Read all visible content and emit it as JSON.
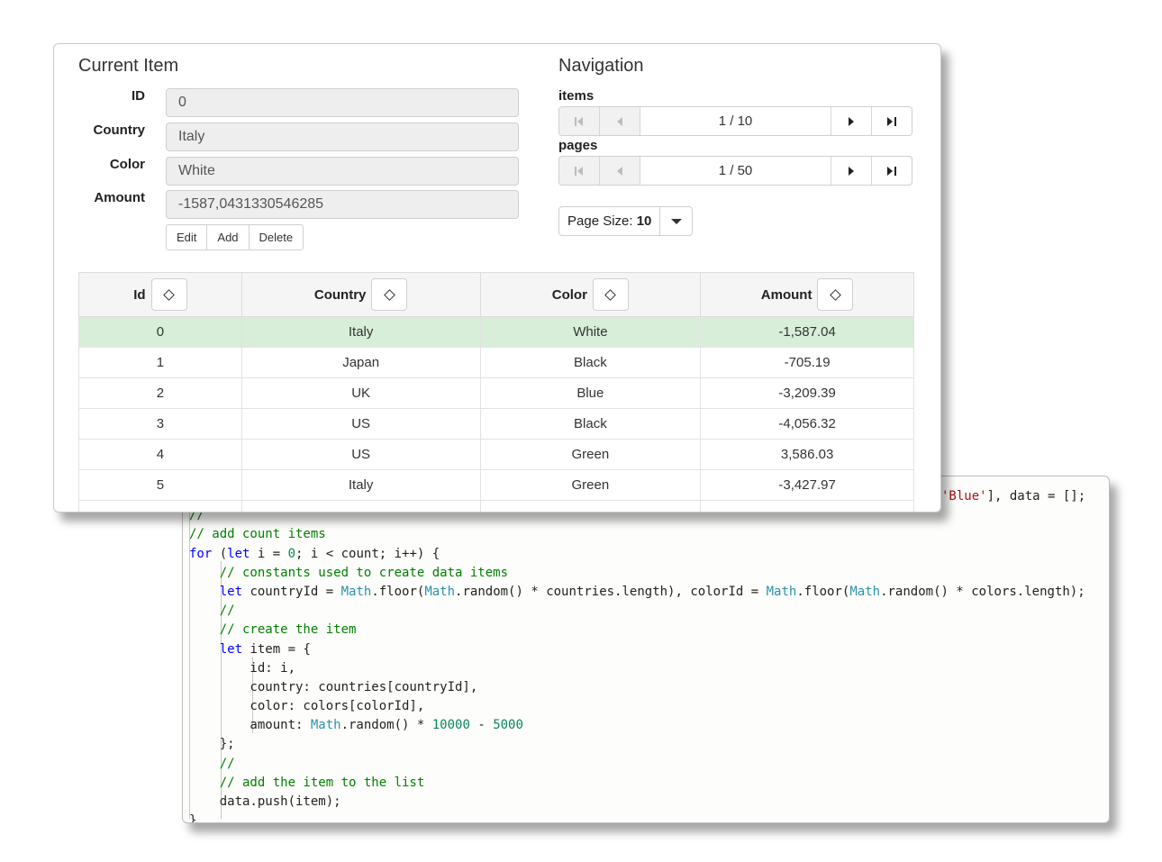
{
  "current_item": {
    "title": "Current Item",
    "fields": [
      {
        "label": "ID",
        "value": "0"
      },
      {
        "label": "Country",
        "value": "Italy"
      },
      {
        "label": "Color",
        "value": "White"
      },
      {
        "label": "Amount",
        "value": "-1587,0431330546285"
      }
    ],
    "buttons": {
      "edit": "Edit",
      "add": "Add",
      "delete": "Delete"
    }
  },
  "navigation": {
    "title": "Navigation",
    "items": {
      "label": "items",
      "position": "1 / 10"
    },
    "pages": {
      "label": "pages",
      "position": "1 / 50"
    },
    "page_size": {
      "label": "Page Size: ",
      "value": "10"
    }
  },
  "grid": {
    "columns": [
      "Id",
      "Country",
      "Color",
      "Amount"
    ],
    "selected_row": 0,
    "rows": [
      [
        "0",
        "Italy",
        "White",
        "-1,587.04"
      ],
      [
        "1",
        "Japan",
        "Black",
        "-705.19"
      ],
      [
        "2",
        "UK",
        "Blue",
        "-3,209.39"
      ],
      [
        "3",
        "US",
        "Black",
        "-4,056.32"
      ],
      [
        "4",
        "US",
        "Green",
        "3,586.03"
      ],
      [
        "5",
        "Italy",
        "Green",
        "-3,427.97"
      ],
      [
        "",
        "",
        "",
        ""
      ]
    ]
  },
  "code": {
    "lines": [
      [
        {
          "t": "str",
          "s": "'Blue'"
        },
        {
          "t": "plain",
          "s": "], data = [];"
        }
      ],
      [
        {
          "t": "com",
          "s": "//"
        }
      ],
      [
        {
          "t": "com",
          "s": "// add count items"
        }
      ],
      [
        {
          "t": "kw",
          "s": "for"
        },
        {
          "t": "plain",
          "s": " ("
        },
        {
          "t": "kw",
          "s": "let"
        },
        {
          "t": "plain",
          "s": " i = "
        },
        {
          "t": "num",
          "s": "0"
        },
        {
          "t": "plain",
          "s": "; i < count; i++) {"
        }
      ],
      [
        {
          "t": "plain",
          "s": "    "
        },
        {
          "t": "com",
          "s": "// constants used to create data items"
        }
      ],
      [
        {
          "t": "plain",
          "s": "    "
        },
        {
          "t": "kw",
          "s": "let"
        },
        {
          "t": "plain",
          "s": " countryId = "
        },
        {
          "t": "cls",
          "s": "Math"
        },
        {
          "t": "plain",
          "s": ".floor("
        },
        {
          "t": "cls",
          "s": "Math"
        },
        {
          "t": "plain",
          "s": ".random() * countries.length), colorId = "
        },
        {
          "t": "cls",
          "s": "Math"
        },
        {
          "t": "plain",
          "s": ".floor("
        },
        {
          "t": "cls",
          "s": "Math"
        },
        {
          "t": "plain",
          "s": ".random() * colors.length);"
        }
      ],
      [
        {
          "t": "plain",
          "s": "    "
        },
        {
          "t": "com",
          "s": "//"
        }
      ],
      [
        {
          "t": "plain",
          "s": "    "
        },
        {
          "t": "com",
          "s": "// create the item"
        }
      ],
      [
        {
          "t": "plain",
          "s": "    "
        },
        {
          "t": "kw",
          "s": "let"
        },
        {
          "t": "plain",
          "s": " item = {"
        }
      ],
      [
        {
          "t": "plain",
          "s": "        id: i,"
        }
      ],
      [
        {
          "t": "plain",
          "s": "        country: countries[countryId],"
        }
      ],
      [
        {
          "t": "plain",
          "s": "        color: colors[colorId],"
        }
      ],
      [
        {
          "t": "plain",
          "s": "        amount: "
        },
        {
          "t": "cls",
          "s": "Math"
        },
        {
          "t": "plain",
          "s": ".random() * "
        },
        {
          "t": "num",
          "s": "10000"
        },
        {
          "t": "plain",
          "s": " - "
        },
        {
          "t": "num",
          "s": "5000"
        }
      ],
      [
        {
          "t": "plain",
          "s": "    };"
        }
      ],
      [
        {
          "t": "plain",
          "s": "    "
        },
        {
          "t": "com",
          "s": "//"
        }
      ],
      [
        {
          "t": "plain",
          "s": "    "
        },
        {
          "t": "com",
          "s": "// add the item to the list"
        }
      ],
      [
        {
          "t": "plain",
          "s": "    data.push(item);"
        }
      ],
      [
        {
          "t": "plain",
          "s": "}"
        }
      ]
    ]
  },
  "colors": {
    "selected_row": "#d8eed9",
    "comment": "#008000",
    "keyword": "#0000ff",
    "class": "#2b91af",
    "number": "#098658",
    "string": "#a31515"
  }
}
